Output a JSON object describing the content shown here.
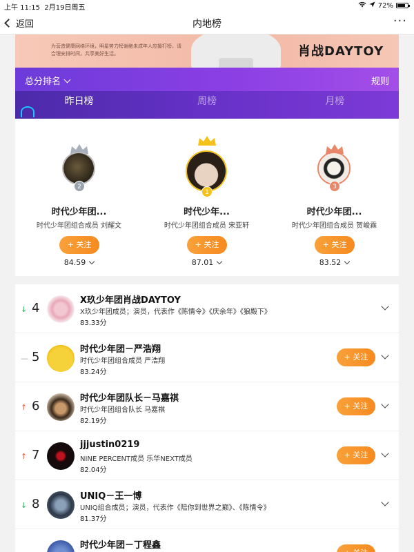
{
  "status": {
    "time": "上午 11:15",
    "date": "2月19日周五",
    "battery": "72%"
  },
  "nav": {
    "back_label": "返回",
    "title": "内地榜",
    "more": "···"
  },
  "banner": {
    "note": "为营造健康网络环境，明星势力榜谢绝未成年人应援打榜，请合理安排时间，共享美好生活。",
    "slogan": "肖战DAYTOY"
  },
  "header": {
    "rank_type": "总分排名",
    "rules": "规则"
  },
  "tabs": [
    {
      "label": "昨日榜"
    },
    {
      "label": "周榜"
    },
    {
      "label": "月榜"
    }
  ],
  "follow_label": "+ 关注",
  "podium": [
    {
      "rank": "2",
      "name": "时代少年团...",
      "desc": "时代少年团组合成员 刘耀文",
      "score": "84.59",
      "crown_color": "#9aa3ad"
    },
    {
      "rank": "1",
      "name": "时代少年...",
      "desc": "时代少年团组合成员 宋亚轩",
      "score": "87.01",
      "crown_color": "#f4c21a"
    },
    {
      "rank": "3",
      "name": "时代少年团...",
      "desc": "时代少年团组合成员 贺峻霖",
      "score": "83.52",
      "crown_color": "#e9876a"
    }
  ],
  "rows": [
    {
      "trend": "↓",
      "rank": "4",
      "name": "X玖少年团肖战DAYTOY",
      "desc": "X玖少年团成员；演员，代表作《陈情令》《庆余年》《狼殿下》",
      "score": "83.33分"
    },
    {
      "trend": "—",
      "rank": "5",
      "name": "时代少年团－严浩翔",
      "desc": "时代少年团组合成员 严浩翔",
      "score": "83.24分"
    },
    {
      "trend": "↑",
      "rank": "6",
      "name": "时代少年团队长－马嘉祺",
      "desc": "时代少年团组合队长 马嘉祺",
      "score": "82.19分"
    },
    {
      "trend": "↑",
      "rank": "7",
      "name": "jjjustin0219",
      "desc": "NINE PERCENT成员 乐华NEXT成员",
      "score": "82.04分"
    },
    {
      "trend": "↓",
      "rank": "8",
      "name": "UNIQ－王一博",
      "desc": "UNIQ组合成员；演员，代表作《陪你到世界之巅》、《陈情令》",
      "score": "81.37分"
    },
    {
      "trend": "",
      "rank": "",
      "name": "时代少年团－丁程鑫",
      "desc": "",
      "score": ""
    }
  ]
}
